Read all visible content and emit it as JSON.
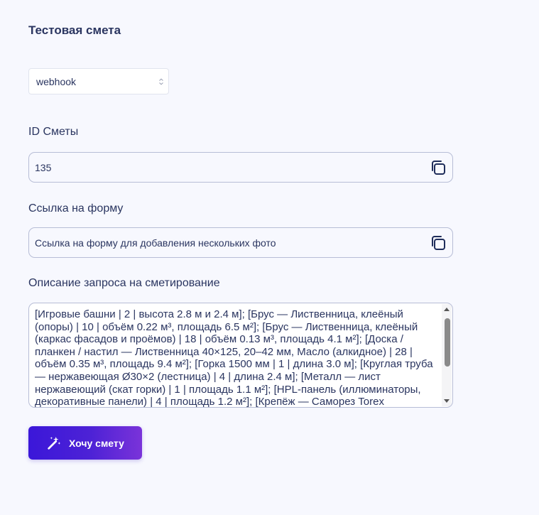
{
  "title": "Тестовая смета",
  "select": {
    "value": "webhook"
  },
  "estimate_id": {
    "label": "ID Сметы",
    "value": "135"
  },
  "form_link": {
    "label": "Ссылка на форму",
    "value": "Ссылка на форму для добавления нескольких фото"
  },
  "description": {
    "label": "Описание запроса на сметирование",
    "value": "[Игровые башни | 2 | высота 2.8 м и 2.4 м];  [Брус — Лиственница, клеёный (опоры) | 10 | объём 0.22 м³, площадь 6.5 м²];  [Брус — Лиственница, клеёный (каркас фасадов и проёмов) | 18 | объём 0.13 м³, площадь 4.1 м²];  [Доска / планкен / настил — Лиственница 40×125, 20–42 мм, Масло (алкидное) | 28 | объём 0.35 м³, площадь 9.4 м²];  [Горка 1500 мм | 1 | длина 3.0 м];  [Круглая труба — нержавеющая Ø30×2 (лестница) | 4 | длина 2.4 м];  [Металл — лист нержавеющий (скат горки) | 1 | площадь 1.1 м²];  [HPL-панель (иллюминаторы, декоративные панели) | 4 | площадь 1.2 м²];  [Крепёж — Саморез Torex"
  },
  "submit_button": {
    "label": "Хочу смету"
  },
  "colors": {
    "accent_start": "#3b17d9",
    "accent_end": "#7a33d9",
    "background": "#f7f8fe",
    "text": "#2a3560"
  },
  "icons": {
    "copy": "copy-icon",
    "wand": "magic-wand-icon",
    "chevron": "chevron-updown-icon"
  }
}
